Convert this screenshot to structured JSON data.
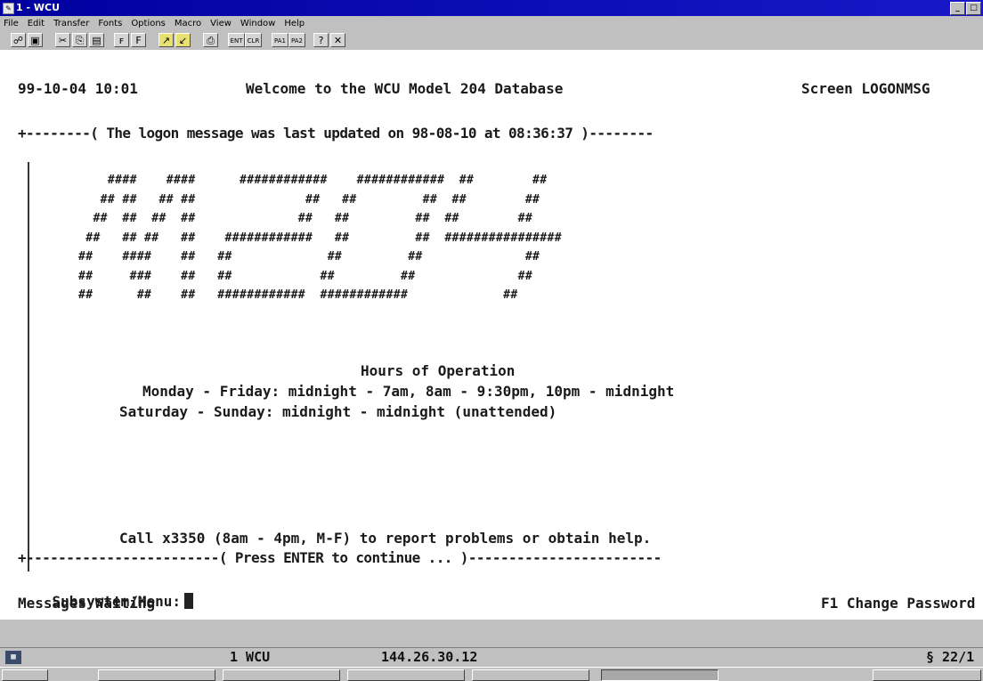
{
  "window": {
    "title": "1 - WCU",
    "controls": [
      "_",
      "□"
    ]
  },
  "menu": [
    "File",
    "Edit",
    "Transfer",
    "Fonts",
    "Options",
    "Macro",
    "View",
    "Window",
    "Help"
  ],
  "toolbar": {
    "enter_label": "ENT",
    "clear_label": "CLR",
    "pa1_label": "PA1",
    "pa2_label": "PA2"
  },
  "terminal": {
    "header_left": "99-10-04 10:01",
    "header_center": "Welcome to the WCU Model 204 Database",
    "header_right": "Screen LOGONMSG",
    "top_separator": "+--------( The logon message was last updated on 98-08-10 at 08:36:37 )--------",
    "banner": [
      "    ####    ####      ############    ############  ##        ##",
      "   ## ##   ## ##               ##   ##         ##  ##        ##",
      "  ##  ##  ##  ##              ##   ##         ##  ##        ##",
      " ##   ## ##   ##    ############   ##         ##  ################",
      "##    ####    ##   ##             ##         ##              ##",
      "##     ###    ##   ##            ##         ##              ##",
      "##      ##    ##   ############  ############             ##"
    ],
    "hours_title": "Hours of Operation",
    "hours_weekday": "Monday - Friday: midnight - 7am, 8am - 9:30pm, 10pm - midnight",
    "hours_weekend": "Saturday - Sunday: midnight - midnight (unattended)",
    "help_line": "Call x3350 (8am - 4pm, M-F) to report problems or obtain help.",
    "bottom_separator": "+------------------------( Press ENTER to continue ... )------------------------",
    "prompt_label": "Subsystem/Menu:",
    "prompt_value": "",
    "messages": "Messages Waiting",
    "f1_label": "F1 Change Password"
  },
  "status": {
    "session": "1 WCU",
    "ip": "144.26.30.12",
    "position": "§ 22/1"
  }
}
